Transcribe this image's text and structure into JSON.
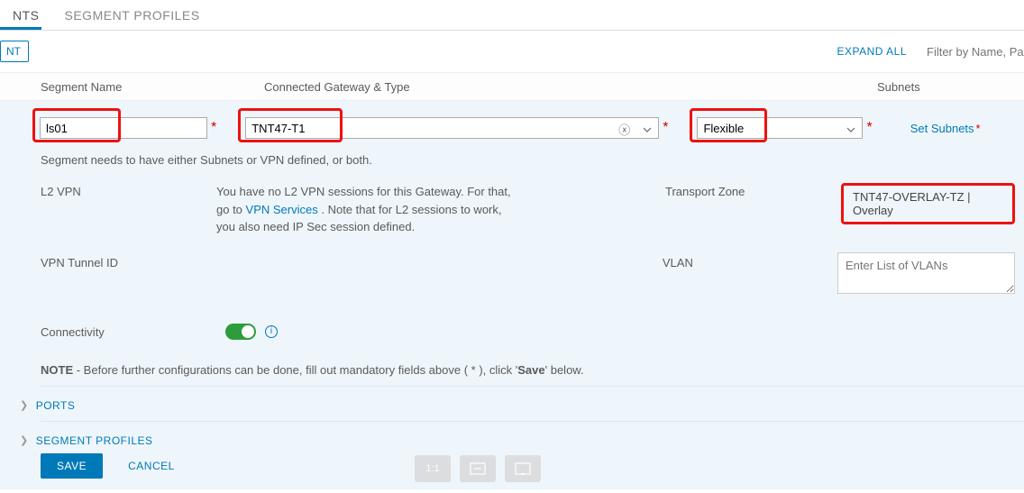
{
  "tabs": {
    "segments": "NTS",
    "profiles": "SEGMENT PROFILES"
  },
  "toolbar": {
    "add": "NT",
    "expand_all": "EXPAND ALL",
    "filter_placeholder": "Filter by Name, Path o"
  },
  "headers": {
    "segment": "Segment Name",
    "gateway": "Connected Gateway & Type",
    "subnets": "Subnets"
  },
  "form": {
    "segment_name": "ls01",
    "gateway": "TNT47-T1",
    "type": "Flexible",
    "set_subnets": "Set Subnets",
    "hint": "Segment needs to have either Subnets or VPN defined, or both.",
    "l2vpn_label": "L2 VPN",
    "l2vpn_text1": "You have no L2 VPN sessions for this Gateway. For that,",
    "l2vpn_text2": "go to ",
    "l2vpn_link": "VPN Services",
    "l2vpn_text3": " . Note that for L2 sessions to work,",
    "l2vpn_text4": "you also need IP Sec session defined.",
    "tz_label": "Transport Zone",
    "tz_value": "TNT47-OVERLAY-TZ | Overlay",
    "tunnel_label": "VPN Tunnel ID",
    "vlan_label": "VLAN",
    "vlan_placeholder": "Enter List of VLANs",
    "conn_label": "Connectivity",
    "note_bold": "NOTE",
    "note_text": " - Before further configurations can be done, fill out mandatory fields above ( * ), click '",
    "note_save": "Save",
    "note_end": "' below."
  },
  "sections": {
    "ports": "PORTS",
    "profiles": "SEGMENT PROFILES"
  },
  "footer": {
    "save": "SAVE",
    "cancel": "CANCEL"
  },
  "req": "*"
}
